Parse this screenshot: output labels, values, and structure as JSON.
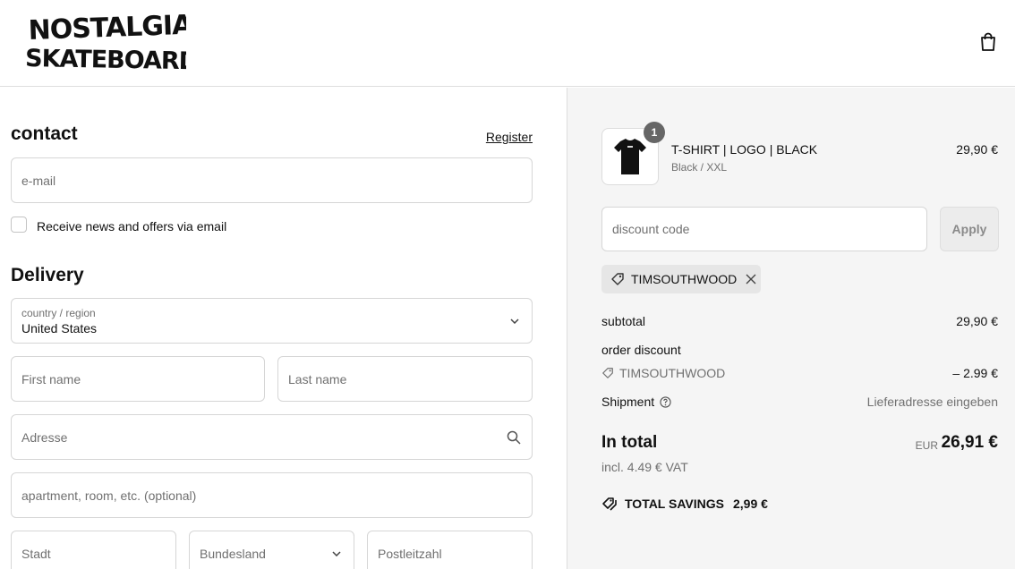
{
  "header": {
    "logo_line1": "NOSTALGIA",
    "logo_line2": "SKATEBOARDS",
    "cart_icon": "shopping-bag-icon"
  },
  "contact": {
    "title": "contact",
    "register_link": "Register",
    "email_placeholder": "e-mail",
    "newsletter_label": "Receive news and offers via email",
    "newsletter_checked": false
  },
  "delivery": {
    "title": "Delivery",
    "country_label": "country / region",
    "country_value": "United States",
    "first_name_placeholder": "First name",
    "last_name_placeholder": "Last name",
    "address_placeholder": "Adresse",
    "apartment_placeholder": "apartment, room, etc. (optional)",
    "city_placeholder": "Stadt",
    "state_placeholder": "Bundesland",
    "zip_placeholder": "Postleitzahl"
  },
  "summary": {
    "item": {
      "title": "T-SHIRT | LOGO | BLACK",
      "variant": "Black / XXL",
      "price": "29,90 €",
      "quantity": "1"
    },
    "discount_placeholder": "discount code",
    "apply_label": "Apply",
    "applied_code": "TIMSOUTHWOOD",
    "subtotal_label": "subtotal",
    "subtotal_value": "29,90 €",
    "order_discount_label": "order discount",
    "order_discount_code": "TIMSOUTHWOOD",
    "order_discount_value": "– 2.99 €",
    "shipment_label": "Shipment",
    "shipment_value": "Lieferadresse eingeben",
    "total_label": "In total",
    "total_currency": "EUR",
    "total_value": "26,91 €",
    "vat_note": "incl. 4.49 € VAT",
    "savings_label": "TOTAL SAVINGS",
    "savings_value": "2,99 €"
  },
  "colors": {
    "summary_bg": "#f5f5f5",
    "border": "#d6d6d6",
    "chip_bg": "#e6e6e6",
    "text": "#111111",
    "muted": "#707070"
  }
}
